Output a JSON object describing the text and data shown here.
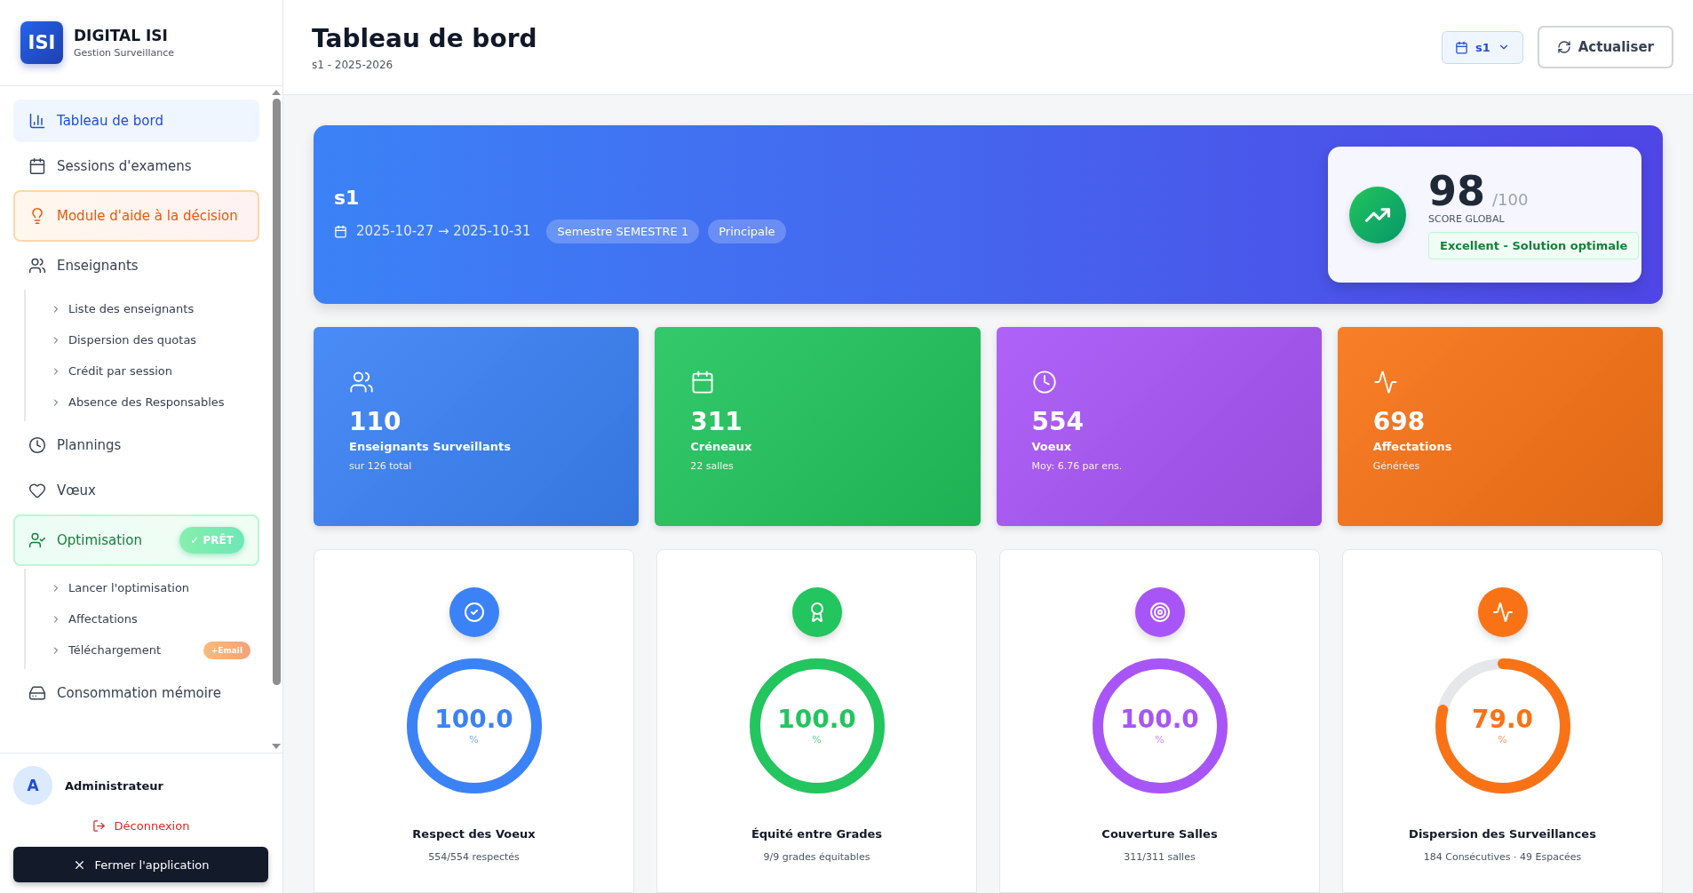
{
  "brand": {
    "logo": "ISI",
    "name": "DIGITAL ISI",
    "subtitle": "Gestion Surveillance"
  },
  "nav": [
    {
      "kind": "item",
      "label": "Tableau de bord",
      "selected": true
    },
    {
      "kind": "item",
      "label": "Sessions d'examens",
      "selected": false
    },
    {
      "kind": "highlight",
      "label": "Module d'aide à la décision",
      "selected": false
    },
    {
      "kind": "item",
      "label": "Enseignants",
      "selected": false,
      "children": [
        {
          "label": "Liste des enseignants"
        },
        {
          "label": "Dispersion des quotas"
        },
        {
          "label": "Crédit par session"
        },
        {
          "label": "Absence des Responsables"
        }
      ]
    },
    {
      "kind": "item",
      "label": "Plannings",
      "selected": false
    },
    {
      "kind": "item",
      "label": "Vœux",
      "selected": false
    },
    {
      "kind": "ready",
      "label": "Optimisation",
      "badge": "✓ PRÊT",
      "selected": false,
      "children": [
        {
          "label": "Lancer l'optimisation"
        },
        {
          "label": "Affectations"
        },
        {
          "label": "Téléchargement",
          "badge": "+Email"
        }
      ]
    },
    {
      "kind": "item",
      "label": "Consommation mémoire",
      "selected": false
    }
  ],
  "user": {
    "initial": "A",
    "name": "Administrateur"
  },
  "logout": "Déconnexion",
  "close_button": "Fermer l'application",
  "header": {
    "title": "Tableau de bord",
    "subtitle": "s1 - 2025-2026",
    "session_select": "s1",
    "refresh_button": "Actualiser"
  },
  "hero": {
    "title": "s1",
    "dates": "2025-10-27 → 2025-10-31",
    "tags": [
      "Semestre SEMESTRE 1",
      "Principale"
    ],
    "score": {
      "value": "98",
      "max": "/100",
      "label": "SCORE GLOBAL",
      "verdict": "Excellent - Solution optimale"
    }
  },
  "stats": [
    {
      "value": "110",
      "label": "Enseignants Surveillants",
      "sub": "sur 126 total",
      "color": "#3b82f6"
    },
    {
      "value": "311",
      "label": "Créneaux",
      "sub": "22 salles",
      "color": "#22c55e"
    },
    {
      "value": "554",
      "label": "Voeux",
      "sub": "Moy: 6.76 par ens.",
      "color": "#a855f7"
    },
    {
      "value": "698",
      "label": "Affectations",
      "sub": "Générées",
      "color": "#f97316"
    }
  ],
  "metrics": [
    {
      "value": "100.0",
      "unit": "%",
      "title": "Respect des Voeux",
      "detail": "554/554 respectés",
      "level": 1,
      "color": "#3b82f6"
    },
    {
      "value": "100.0",
      "unit": "%",
      "title": "Équité entre Grades",
      "detail": "9/9 grades équitables",
      "level": 1,
      "color": "#22c55e"
    },
    {
      "value": "100.0",
      "unit": "%",
      "title": "Couverture Salles",
      "detail": "311/311 salles",
      "level": 1,
      "color": "#a855f7"
    },
    {
      "value": "79.0",
      "unit": "%",
      "title": "Dispersion des Surveillances",
      "detail": "184 Consécutives · 49 Espacées",
      "level": 0.79,
      "color": "#f97316"
    }
  ]
}
